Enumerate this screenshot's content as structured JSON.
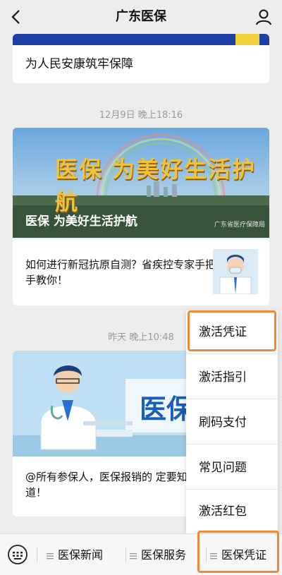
{
  "header": {
    "title": "广东医保"
  },
  "messages": [
    {
      "text": "为人民安康筑牢保障"
    }
  ],
  "timestamps": [
    "12月9日 晚上18:16",
    "昨天 晚上10:48"
  ],
  "article1": {
    "banner_calligraphy": "医保 为美好生活护航",
    "headline": "医保 为美好生活护航",
    "logo_text": "广东省医疗保障局",
    "sub_title": "如何进行新冠抗原自测？省疾控专家手把手教你！"
  },
  "article2": {
    "banner_text": "医保",
    "sub_title": "@所有参保人，医保报销的 定要知道！"
  },
  "popup_menu": {
    "items": [
      "激活凭证",
      "激活指引",
      "刷码支付",
      "常见问题",
      "激活红包"
    ]
  },
  "bottom_menu": {
    "tabs": [
      "医保新闻",
      "医保服务",
      "医保凭证"
    ]
  },
  "colors": {
    "highlight": "#ef8a3a",
    "banner_blue": "#1a5fb4"
  }
}
